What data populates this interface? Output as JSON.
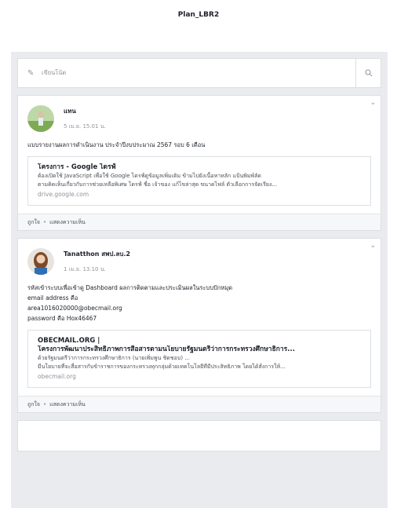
{
  "page": {
    "title": "Plan_LBR2"
  },
  "composer": {
    "placeholder": "เขียนโน้ต",
    "pencil_icon": "pencil-icon",
    "search_icon": "search-icon"
  },
  "actions": {
    "like": "ถูกใจ",
    "separator": "•",
    "comment": "แสดงความเห็น"
  },
  "posts": [
    {
      "author": "แทน",
      "time": "5 เม.ย. 15.01 น.",
      "lines": [
        "แบบรายงานผลการดำเนินงาน ประจำปีงบประมาณ 2567 รอบ 6 เดือน"
      ],
      "link": {
        "title": "โครงการ - Google ไดรฟ์",
        "desc": [
          "ต้องเปิดใช้ JavaScript เพื่อใช้ Google ไดรฟ์ดูข้อมูลเพิ่มเติม ข้ามไปยังเนื้อหาหลัก แป้นพิมพ์ลัด",
          "ตามคิดเห็นเกี่ยวกับการช่วยเหลือพิเศษ ไดรฟ์ ชื่อ เจ้าของ แก้ไขล่าสุด ขนาดไฟล์ ตัวเลือกการจัดเรียง..."
        ],
        "domain": "drive.google.com"
      }
    },
    {
      "author": "Tanatthon สพป.ลบ.2",
      "time": "1 เม.ย. 13.10 น.",
      "lines": [
        "รหัสเข้าระบบเพื่อเข้าดู Dashboard ผลการติดตามและประเมินผลในระบบปักหมุด",
        "email address คือ",
        "area1016020000@obecmail.org",
        "password  คือ Hox46467"
      ],
      "link": {
        "title": "OBECMAIL.ORG |",
        "title2": "โครงการพัฒนาประสิทธิภาพการสื่อสารตามนโยบายรัฐมนตรีว่าการกระทรวงศึกษาธิการ...",
        "desc": [
          "ด้วยรัฐมนตรีว่าการกระทรวงศึกษาธิการ (นายเพิ่มพูน ชิดชอบ) ...",
          "มีนโยบายที่จะสื่อสารกับข้าราชการของกระทรวงทุกกลุ่มด้วยเทคโนโลยีที่มีประสิทธิภาพ โดยได้สั่งการให้..."
        ],
        "domain": "obecmail.org"
      }
    }
  ]
}
